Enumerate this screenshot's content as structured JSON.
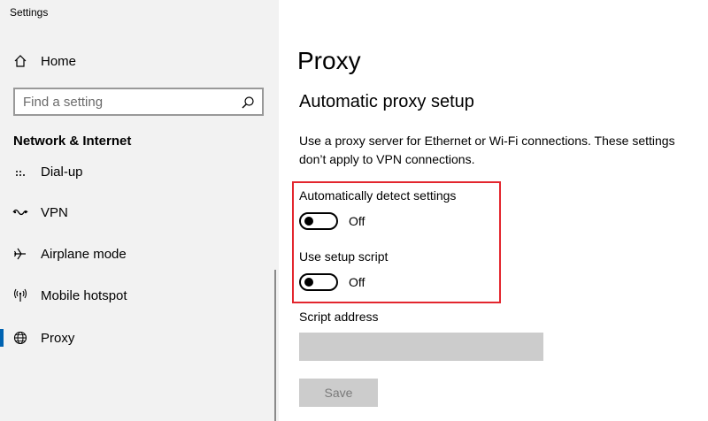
{
  "window": {
    "title": "Settings"
  },
  "sidebar": {
    "home_label": "Home",
    "search_placeholder": "Find a setting",
    "section_title": "Network & Internet",
    "items": [
      {
        "label": "Dial-up",
        "icon": "dialup-icon"
      },
      {
        "label": "VPN",
        "icon": "vpn-icon"
      },
      {
        "label": "Airplane mode",
        "icon": "airplane-icon"
      },
      {
        "label": "Mobile hotspot",
        "icon": "hotspot-icon"
      },
      {
        "label": "Proxy",
        "icon": "globe-icon",
        "selected": true
      }
    ]
  },
  "main": {
    "title": "Proxy",
    "section": "Automatic proxy setup",
    "description": "Use a proxy server for Ethernet or Wi-Fi connections. These settings don’t apply to VPN connections.",
    "auto_detect": {
      "label": "Automatically detect settings",
      "state": "Off",
      "on": false
    },
    "setup_script": {
      "label": "Use setup script",
      "state": "Off",
      "on": false
    },
    "script_address_label": "Script address",
    "script_address_value": "",
    "save_label": "Save"
  },
  "colors": {
    "accent": "#0063b1",
    "highlight_border": "#e3262e",
    "sidebar_bg": "#f2f2f2",
    "disabled": "#cccccc"
  }
}
